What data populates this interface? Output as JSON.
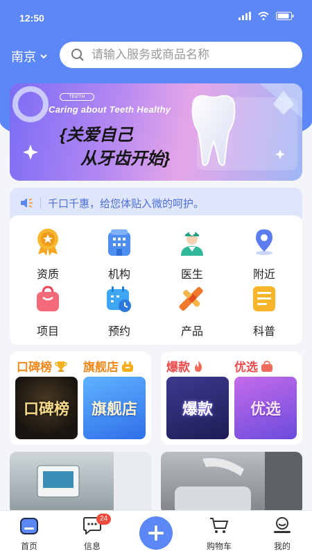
{
  "status": {
    "time": "12:50"
  },
  "header": {
    "city": "南京",
    "search_placeholder": "请输入服务或商品名称"
  },
  "banner": {
    "tag": "TEETH",
    "subtitle": "Caring about Teeth Healthy",
    "line1": "{关爱自己",
    "line2": "从牙齿开始}"
  },
  "notice": {
    "text": "千口千惠，给您体贴入微的呵护。"
  },
  "categories": [
    {
      "label": "资质",
      "icon": "medal-icon"
    },
    {
      "label": "机构",
      "icon": "building-icon"
    },
    {
      "label": "医生",
      "icon": "doctor-icon"
    },
    {
      "label": "附近",
      "icon": "location-pin-icon"
    },
    {
      "label": "项目",
      "icon": "bag-icon"
    },
    {
      "label": "预约",
      "icon": "calendar-clock-icon"
    },
    {
      "label": "产品",
      "icon": "toothbrush-icon"
    },
    {
      "label": "科普",
      "icon": "document-icon"
    }
  ],
  "promos": {
    "left": [
      {
        "title": "口碑榜",
        "image_text": "口碑榜",
        "icon": "trophy-icon"
      },
      {
        "title": "旗舰店",
        "image_text": "旗舰店",
        "icon": "shop-icon"
      }
    ],
    "right": [
      {
        "title": "爆款",
        "image_text": "爆款",
        "icon": "fire-icon"
      },
      {
        "title": "优选",
        "image_text": "优选",
        "icon": "basket-icon"
      }
    ]
  },
  "tabbar": {
    "home": "首页",
    "messages": "信息",
    "messages_badge": "24",
    "cart": "购物车",
    "mine": "我的"
  },
  "colors": {
    "primary": "#5b87f7",
    "title_orange": "#f08a1c",
    "title_red": "#ef4d4d",
    "notice_text": "#4b6fd9"
  }
}
